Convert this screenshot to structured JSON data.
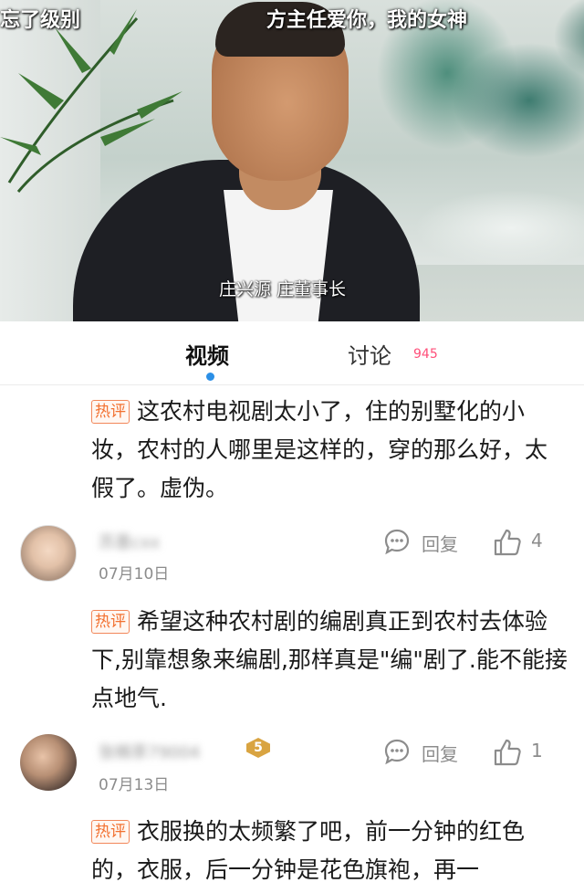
{
  "video": {
    "subtitle_left": "忘了级别",
    "subtitle_right": "方主任爱你，我的女神",
    "caption": "庄兴源 庄董事长"
  },
  "tabs": {
    "video_label": "视频",
    "discuss_label": "讨论",
    "discuss_count": "945"
  },
  "colors": {
    "hot_badge": "#f2702f",
    "count_pink": "#ff4f7a",
    "active_dot": "#2b8fe6"
  },
  "comments": [
    {
      "hot_label": "热评",
      "text": "这农村电视剧太小了，住的别墅化的小妆，农村的人哪里是这样的，穿的那么好，太假了。虚伪。",
      "username": "苏墨cxx",
      "date": "07月10日",
      "reply_label": "回复",
      "likes": "4"
    },
    {
      "hot_label": "热评",
      "text": "希望这种农村剧的编剧真正到农村去体验下,别靠想象来编剧,那样真是\"编\"剧了.能不能接点地气.",
      "username": "张楠茶79004",
      "level": "5",
      "date": "07月13日",
      "reply_label": "回复",
      "likes": "1"
    },
    {
      "hot_label": "热评",
      "text": "衣服换的太频繁了吧，前一分钟的红色的，衣服，后一分钟是花色旗袍，再一"
    }
  ]
}
